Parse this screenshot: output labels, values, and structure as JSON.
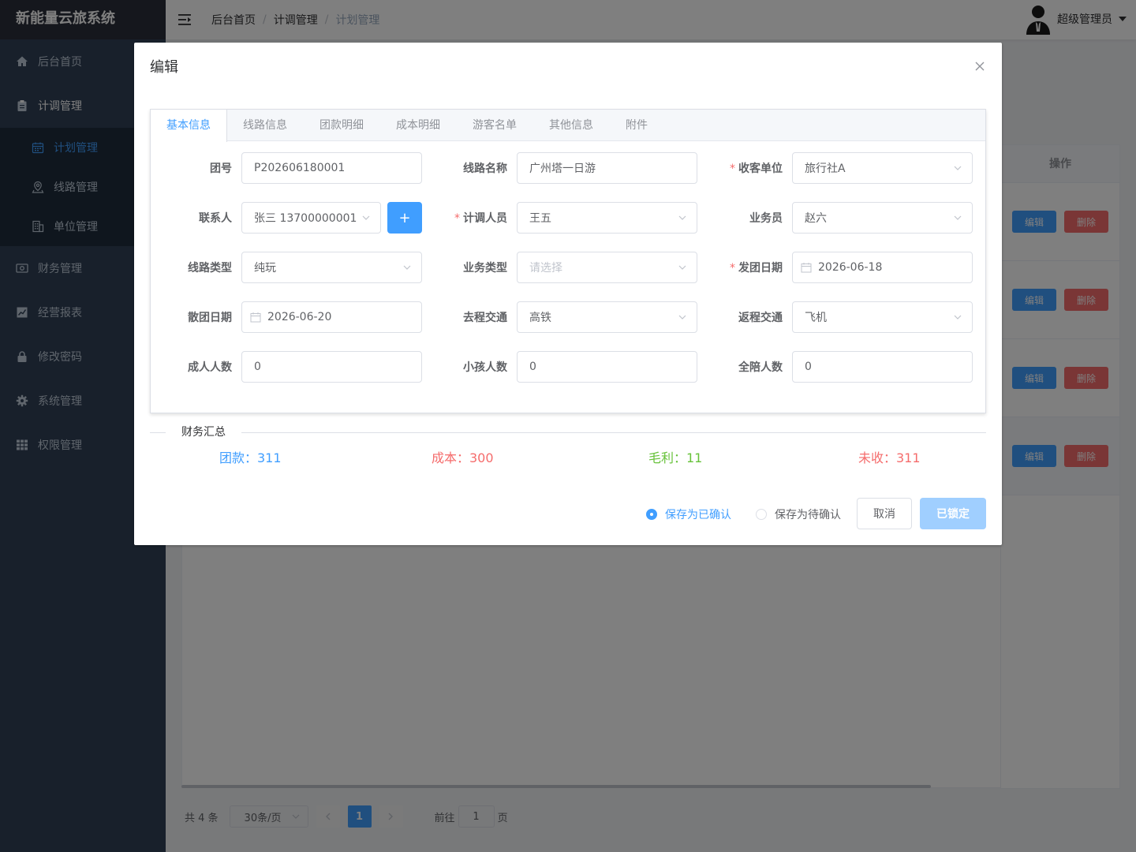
{
  "app": {
    "title": "新能量云旅系统"
  },
  "sidebar": {
    "items": [
      {
        "label": "后台首页",
        "icon": "home-icon"
      },
      {
        "label": "计调管理",
        "icon": "clipboard-icon"
      },
      {
        "label": "计划管理",
        "icon": "calendar-icon"
      },
      {
        "label": "线路管理",
        "icon": "map-pin-icon"
      },
      {
        "label": "单位管理",
        "icon": "building-icon"
      },
      {
        "label": "财务管理",
        "icon": "money-icon"
      },
      {
        "label": "经营报表",
        "icon": "chart-icon"
      },
      {
        "label": "修改密码",
        "icon": "lock-icon"
      },
      {
        "label": "系统管理",
        "icon": "gear-icon"
      },
      {
        "label": "权限管理",
        "icon": "grid-icon"
      }
    ]
  },
  "header": {
    "breadcrumb": [
      "后台首页",
      "计调管理",
      "计划管理"
    ],
    "user": "超级管理员"
  },
  "table": {
    "op_header": "操作",
    "edit_label": "编辑",
    "delete_label": "删除",
    "row_count": 4
  },
  "pager": {
    "total": "共 4 条",
    "page_size": "30条/页",
    "current_page": "1",
    "goto_prefix": "前往",
    "goto_value": "1",
    "goto_suffix": "页"
  },
  "dialog": {
    "title": "编辑",
    "tabs": [
      "基本信息",
      "线路信息",
      "团款明细",
      "成本明细",
      "游客名单",
      "其他信息",
      "附件"
    ],
    "form": {
      "group_no": {
        "label": "团号",
        "value": "P202606180001"
      },
      "route_name": {
        "label": "线路名称",
        "value": "广州塔一日游"
      },
      "customer_unit": {
        "label": "收客单位",
        "value": "旅行社A"
      },
      "contact": {
        "label": "联系人",
        "value": "张三 13700000001",
        "add": "+"
      },
      "planner": {
        "label": "计调人员",
        "value": "王五"
      },
      "salesman": {
        "label": "业务员",
        "value": "赵六"
      },
      "route_type": {
        "label": "线路类型",
        "value": "纯玩"
      },
      "business_type": {
        "label": "业务类型",
        "placeholder": "请选择"
      },
      "depart_date": {
        "label": "发团日期",
        "value": "2026-06-18"
      },
      "dismiss_date": {
        "label": "散团日期",
        "value": "2026-06-20"
      },
      "go_transport": {
        "label": "去程交通",
        "value": "高铁"
      },
      "return_transport": {
        "label": "返程交通",
        "value": "飞机"
      },
      "adults": {
        "label": "成人人数",
        "value": "0"
      },
      "children": {
        "label": "小孩人数",
        "value": "0"
      },
      "escorts": {
        "label": "全陪人数",
        "value": "0"
      }
    },
    "finance": {
      "title": "财务汇总",
      "group_fee": "团款：311",
      "cost": "成本：300",
      "profit": "毛利：11",
      "unpaid": "未收：311"
    },
    "footer": {
      "radio_confirmed": "保存为已确认",
      "radio_pending": "保存为待确认",
      "cancel": "取消",
      "locked": "已锁定"
    }
  },
  "colors": {
    "primary": "#409eff",
    "danger": "#f56c6c",
    "success": "#67c23a",
    "sidebar_bg": "#304156"
  }
}
